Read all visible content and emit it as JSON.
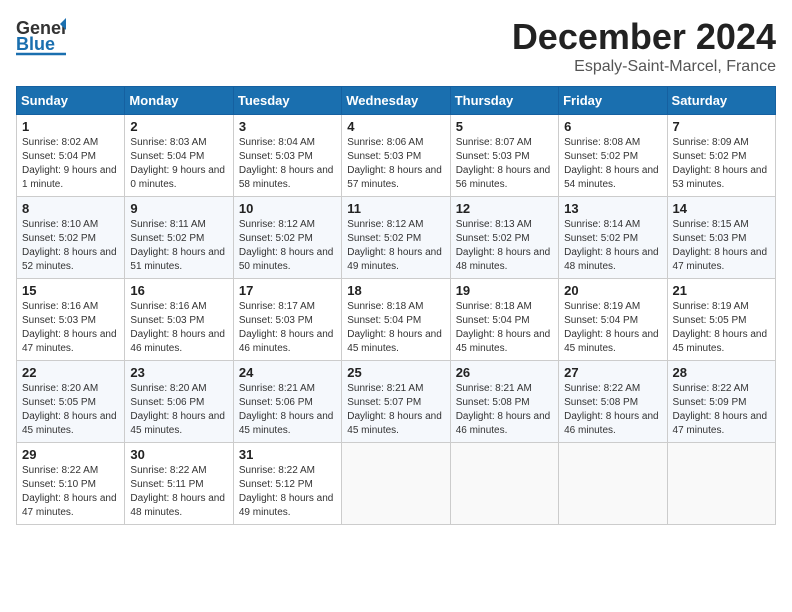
{
  "header": {
    "logo_line1": "General",
    "logo_line2": "Blue",
    "month_title": "December 2024",
    "location": "Espaly-Saint-Marcel, France"
  },
  "weekdays": [
    "Sunday",
    "Monday",
    "Tuesday",
    "Wednesday",
    "Thursday",
    "Friday",
    "Saturday"
  ],
  "weeks": [
    [
      {
        "day": "1",
        "sunrise": "8:02 AM",
        "sunset": "5:04 PM",
        "daylight": "9 hours and 1 minute."
      },
      {
        "day": "2",
        "sunrise": "8:03 AM",
        "sunset": "5:04 PM",
        "daylight": "9 hours and 0 minutes."
      },
      {
        "day": "3",
        "sunrise": "8:04 AM",
        "sunset": "5:03 PM",
        "daylight": "8 hours and 58 minutes."
      },
      {
        "day": "4",
        "sunrise": "8:06 AM",
        "sunset": "5:03 PM",
        "daylight": "8 hours and 57 minutes."
      },
      {
        "day": "5",
        "sunrise": "8:07 AM",
        "sunset": "5:03 PM",
        "daylight": "8 hours and 56 minutes."
      },
      {
        "day": "6",
        "sunrise": "8:08 AM",
        "sunset": "5:02 PM",
        "daylight": "8 hours and 54 minutes."
      },
      {
        "day": "7",
        "sunrise": "8:09 AM",
        "sunset": "5:02 PM",
        "daylight": "8 hours and 53 minutes."
      }
    ],
    [
      {
        "day": "8",
        "sunrise": "8:10 AM",
        "sunset": "5:02 PM",
        "daylight": "8 hours and 52 minutes."
      },
      {
        "day": "9",
        "sunrise": "8:11 AM",
        "sunset": "5:02 PM",
        "daylight": "8 hours and 51 minutes."
      },
      {
        "day": "10",
        "sunrise": "8:12 AM",
        "sunset": "5:02 PM",
        "daylight": "8 hours and 50 minutes."
      },
      {
        "day": "11",
        "sunrise": "8:12 AM",
        "sunset": "5:02 PM",
        "daylight": "8 hours and 49 minutes."
      },
      {
        "day": "12",
        "sunrise": "8:13 AM",
        "sunset": "5:02 PM",
        "daylight": "8 hours and 48 minutes."
      },
      {
        "day": "13",
        "sunrise": "8:14 AM",
        "sunset": "5:02 PM",
        "daylight": "8 hours and 48 minutes."
      },
      {
        "day": "14",
        "sunrise": "8:15 AM",
        "sunset": "5:03 PM",
        "daylight": "8 hours and 47 minutes."
      }
    ],
    [
      {
        "day": "15",
        "sunrise": "8:16 AM",
        "sunset": "5:03 PM",
        "daylight": "8 hours and 47 minutes."
      },
      {
        "day": "16",
        "sunrise": "8:16 AM",
        "sunset": "5:03 PM",
        "daylight": "8 hours and 46 minutes."
      },
      {
        "day": "17",
        "sunrise": "8:17 AM",
        "sunset": "5:03 PM",
        "daylight": "8 hours and 46 minutes."
      },
      {
        "day": "18",
        "sunrise": "8:18 AM",
        "sunset": "5:04 PM",
        "daylight": "8 hours and 45 minutes."
      },
      {
        "day": "19",
        "sunrise": "8:18 AM",
        "sunset": "5:04 PM",
        "daylight": "8 hours and 45 minutes."
      },
      {
        "day": "20",
        "sunrise": "8:19 AM",
        "sunset": "5:04 PM",
        "daylight": "8 hours and 45 minutes."
      },
      {
        "day": "21",
        "sunrise": "8:19 AM",
        "sunset": "5:05 PM",
        "daylight": "8 hours and 45 minutes."
      }
    ],
    [
      {
        "day": "22",
        "sunrise": "8:20 AM",
        "sunset": "5:05 PM",
        "daylight": "8 hours and 45 minutes."
      },
      {
        "day": "23",
        "sunrise": "8:20 AM",
        "sunset": "5:06 PM",
        "daylight": "8 hours and 45 minutes."
      },
      {
        "day": "24",
        "sunrise": "8:21 AM",
        "sunset": "5:06 PM",
        "daylight": "8 hours and 45 minutes."
      },
      {
        "day": "25",
        "sunrise": "8:21 AM",
        "sunset": "5:07 PM",
        "daylight": "8 hours and 45 minutes."
      },
      {
        "day": "26",
        "sunrise": "8:21 AM",
        "sunset": "5:08 PM",
        "daylight": "8 hours and 46 minutes."
      },
      {
        "day": "27",
        "sunrise": "8:22 AM",
        "sunset": "5:08 PM",
        "daylight": "8 hours and 46 minutes."
      },
      {
        "day": "28",
        "sunrise": "8:22 AM",
        "sunset": "5:09 PM",
        "daylight": "8 hours and 47 minutes."
      }
    ],
    [
      {
        "day": "29",
        "sunrise": "8:22 AM",
        "sunset": "5:10 PM",
        "daylight": "8 hours and 47 minutes."
      },
      {
        "day": "30",
        "sunrise": "8:22 AM",
        "sunset": "5:11 PM",
        "daylight": "8 hours and 48 minutes."
      },
      {
        "day": "31",
        "sunrise": "8:22 AM",
        "sunset": "5:12 PM",
        "daylight": "8 hours and 49 minutes."
      },
      null,
      null,
      null,
      null
    ]
  ],
  "labels": {
    "sunrise": "Sunrise:",
    "sunset": "Sunset:",
    "daylight": "Daylight:"
  }
}
